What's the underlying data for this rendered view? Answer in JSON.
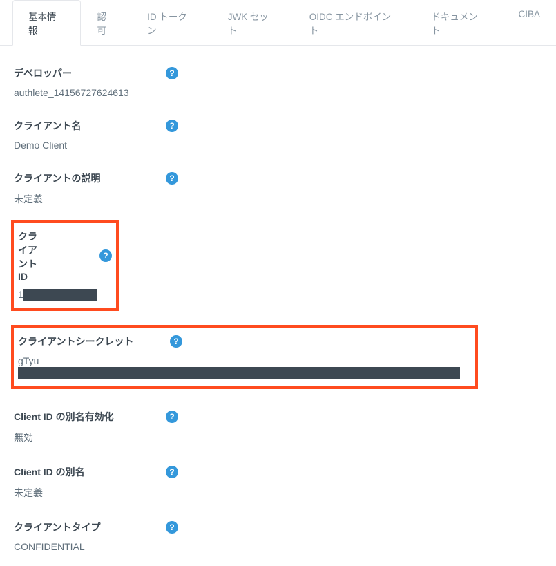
{
  "tabs": {
    "items": [
      {
        "label": "基本情報",
        "active": true
      },
      {
        "label": "認可",
        "active": false
      },
      {
        "label": "ID トークン",
        "active": false
      },
      {
        "label": "JWK セット",
        "active": false
      },
      {
        "label": "OIDC エンドポイント",
        "active": false
      },
      {
        "label": "ドキュメント",
        "active": false
      },
      {
        "label": "CIBA",
        "active": false
      }
    ]
  },
  "fields": {
    "developer": {
      "label": "デベロッパー",
      "value": "authlete_14156727624613"
    },
    "clientName": {
      "label": "クライアント名",
      "value": "Demo Client"
    },
    "clientDescription": {
      "label": "クライアントの説明",
      "value": "未定義"
    },
    "clientId": {
      "label": "クライアント ID",
      "valuePrefix": "1"
    },
    "clientSecret": {
      "label": "クライアントシークレット",
      "valuePrefix": "gTyu"
    },
    "clientIdAliasEnabled": {
      "label": "Client ID の別名有効化",
      "value": "無効"
    },
    "clientIdAlias": {
      "label": "Client ID の別名",
      "value": "未定義"
    },
    "clientType": {
      "label": "クライアントタイプ",
      "value": "CONFIDENTIAL"
    }
  },
  "help": {
    "glyph": "?"
  },
  "colors": {
    "highlight": "#ff4b1f",
    "redact": "#3d4852",
    "help": "#3498db"
  }
}
